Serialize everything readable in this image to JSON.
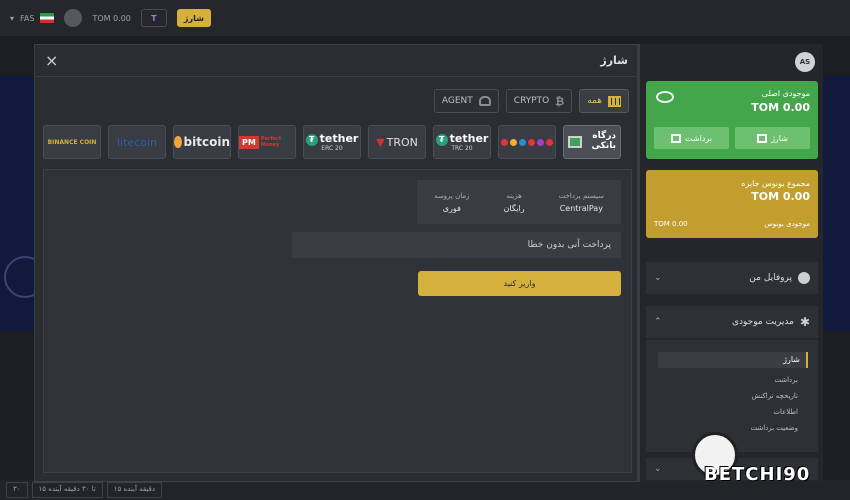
{
  "topbar": {
    "lang": "FAS",
    "balance": "TOM 0.00",
    "t_badge": "T",
    "charge": "شارژ"
  },
  "bottom_strip": [
    "۳۰",
    "۱۵ تا ۳۰ دقیقه آینده",
    "۱۵ دقیقه آینده"
  ],
  "modal": {
    "title": "شارژ",
    "close": "×",
    "filters": [
      {
        "label": "AGENT",
        "icon": "agent-icon"
      },
      {
        "label": "CRYPTO",
        "icon": "bitcoin-icon"
      },
      {
        "label": "همه",
        "icon": "grid-icon",
        "active": true
      }
    ],
    "methods": {
      "binance": "BINANCE COIN",
      "litecoin": "litecoin",
      "bitcoin": "bitcoin",
      "pm": "PM",
      "pm_sub": "Perfect Money",
      "tether": "tether",
      "erc": "ERC 20",
      "tron": "TRON",
      "trc": "TRC 20",
      "bank": "درگاه بانکی"
    },
    "info": {
      "system_label": "سیستم پرداخت",
      "system_value": "CentralPay",
      "fee_label": "هزینه",
      "fee_value": "رایگان",
      "time_label": "زمان پروسه",
      "time_value": "فوری"
    },
    "error": "پرداخت آنی بدون خطا",
    "deposit_button": "واریز کنید"
  },
  "sidebar": {
    "avatar": "AS",
    "main_wallet_label": "موجودی اصلی",
    "main_wallet_value": "TOM 0.00",
    "charge": "شارژ",
    "withdraw": "برداشت",
    "bonus_label": "مجموع بونوس جایزه",
    "bonus_value": "TOM 0.00",
    "bonus_sub_label": "موجودی بونوس",
    "bonus_sub_value": "TOM 0.00",
    "profile": "پروفایل من",
    "wallet_management": "مدیریت موجودی",
    "submenu": [
      "شارژ",
      "برداشت",
      "تاریخچه تراکنش",
      "اطلاعات",
      "وضعیت برداشت"
    ]
  },
  "watermark": "BETCHI90"
}
